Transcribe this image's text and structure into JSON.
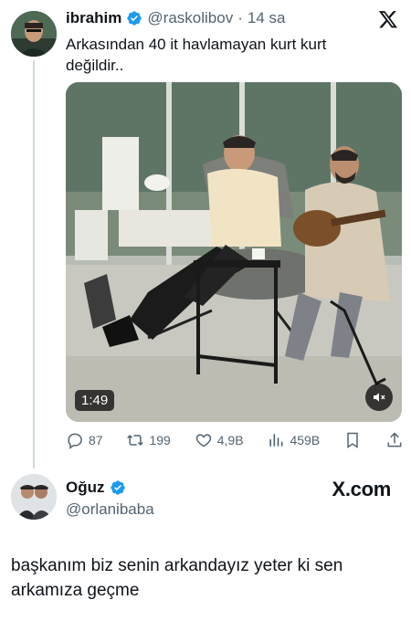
{
  "tweet": {
    "author_name": "ibrahim",
    "handle": "@raskolibov",
    "separator": "·",
    "time": "14 sa",
    "text": "Arkasından 40 it havlamayan kurt kurt değildir..",
    "video_duration": "1:49",
    "actions": {
      "replies": "87",
      "reposts": "199",
      "likes": "4,9B",
      "views": "459B"
    }
  },
  "reply": {
    "author_name": "Oğuz",
    "handle": "@orlanibaba",
    "brand": "X.com",
    "text": "başkanım biz senin arkandayız yeter ki sen arkamıza geçme"
  },
  "icons": {
    "verified": "verified-badge-icon",
    "x_logo": "x-logo-icon",
    "reply": "reply-icon",
    "repost": "repost-icon",
    "like": "heart-icon",
    "views": "views-bar-chart-icon",
    "bookmark": "bookmark-icon",
    "share": "share-icon",
    "mute": "speaker-muted-icon"
  },
  "colors": {
    "verified_blue": "#1d9bf0",
    "secondary_text": "#536471",
    "thread_line": "#cfd9de"
  }
}
